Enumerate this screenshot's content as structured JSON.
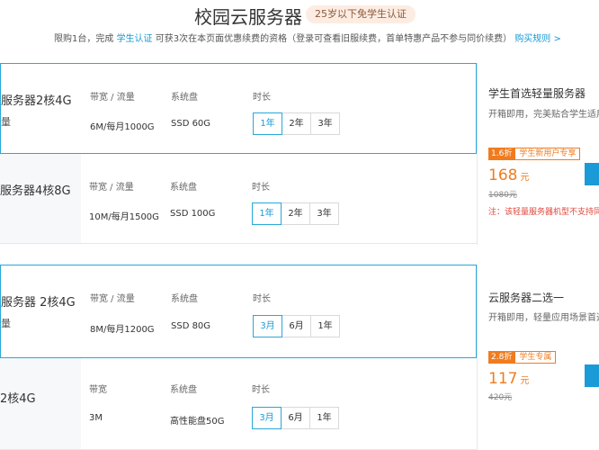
{
  "header": {
    "title": "校园云服务器",
    "badge": "25岁以下免学生认证",
    "sub_pre": "限购1台，完成",
    "sub_link": "学生认证",
    "sub_mid": " 可获3次在本页面优惠续费的资格（登录可查看旧服续费，首单特惠产品不参与同价续费）",
    "rules_link": "购买规则 >"
  },
  "groups": [
    {
      "plans": [
        {
          "name": "服务器2核4G",
          "sub": "量",
          "labels": [
            "带宽 / 流量",
            "系统盘",
            "时长"
          ],
          "bandwidth": "6M/每月1000G",
          "disk": "SSD 60G",
          "durations": [
            "1年",
            "2年",
            "3年"
          ],
          "selected": "1年"
        },
        {
          "name": "服务器4核8G",
          "sub": "",
          "labels": [
            "带宽 / 流量",
            "系统盘",
            "时长"
          ],
          "bandwidth": "10M/每月1500G",
          "disk": "SSD 100G",
          "durations": [
            "1年",
            "2年",
            "3年"
          ],
          "selected": "1年"
        }
      ],
      "side": {
        "title": "学生首选轻量服务器",
        "desc": "开箱即用，完美贴合学生适用",
        "discount": "1.6折",
        "tag": "学生新用户专享",
        "price": "168",
        "unit": "元",
        "original": "1080元",
        "note": "注：该轻量服务器机型不支持同价"
      }
    },
    {
      "plans": [
        {
          "name": "服务器 2核4G",
          "sub": "量",
          "labels": [
            "带宽 / 流量",
            "系统盘",
            "时长"
          ],
          "bandwidth": "8M/每月1200G",
          "disk": "SSD 80G",
          "durations": [
            "3月",
            "6月",
            "1年"
          ],
          "selected": "3月"
        },
        {
          "name": "2核4G",
          "sub": "",
          "labels": [
            "带宽",
            "系统盘",
            "时长"
          ],
          "bandwidth": "3M",
          "disk": "高性能盘50G",
          "durations": [
            "3月",
            "6月",
            "1年"
          ],
          "selected": "3月"
        }
      ],
      "side": {
        "title": "云服务器二选一",
        "desc": "开箱即用，轻量应用场景首选",
        "discount": "2.8折",
        "tag": "学生专属",
        "price": "117",
        "unit": "元",
        "original": "420元",
        "note": ""
      }
    }
  ],
  "colors": {
    "accent": "#1a9ad6",
    "border_active": "#28a8d8",
    "price": "#f07c1f",
    "warn": "#e0463b"
  }
}
